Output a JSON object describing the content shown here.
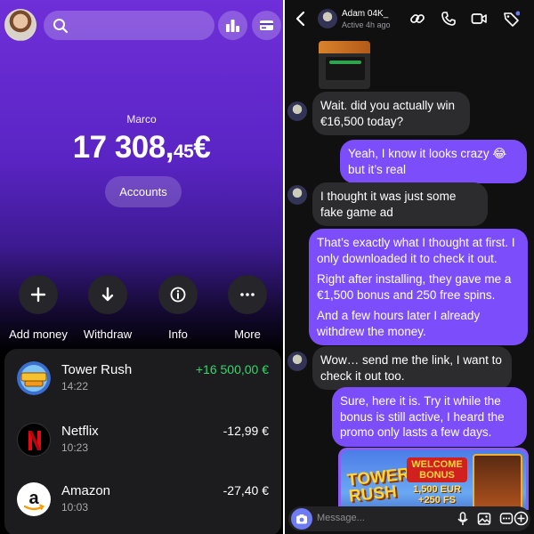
{
  "bank": {
    "owner": "Marco",
    "balance_main": "17 308,",
    "balance_cents": "45",
    "currency": "€",
    "accounts_label": "Accounts",
    "actions": [
      {
        "label": "Add money",
        "icon": "plus-icon"
      },
      {
        "label": "Withdraw",
        "icon": "arrow-down-icon"
      },
      {
        "label": "Info",
        "icon": "info-icon"
      },
      {
        "label": "More",
        "icon": "more-icon"
      }
    ],
    "transactions": [
      {
        "name": "Tower Rush",
        "time": "14:22",
        "amount": "+16 500,00 €",
        "icon": "tower-rush-logo"
      },
      {
        "name": "Netflix",
        "time": "10:23",
        "amount": "-12,99 €",
        "icon": "netflix-logo"
      },
      {
        "name": "Amazon",
        "time": "10:03",
        "amount": "-27,40 €",
        "icon": "amazon-logo"
      }
    ],
    "colors": {
      "accent": "#6f2fd8",
      "positive": "#36d66b"
    }
  },
  "chat": {
    "contact_name": "Adam 04K_",
    "contact_status": "Active 4h ago",
    "messages": [
      {
        "from": "in",
        "paragraphs": [
          "Wait. did you actually win €16,500 today?"
        ]
      },
      {
        "from": "out",
        "paragraphs": [
          "Yeah, I know it looks crazy 😂 but it’s real"
        ]
      },
      {
        "from": "in",
        "paragraphs": [
          "I thought it was just some fake game ad"
        ]
      },
      {
        "from": "out",
        "paragraphs": [
          "That’s exactly what I thought at first. I only downloaded it to check it out.",
          "Right after installing, they gave me a €1,500 bonus and 250 free spins.",
          "And a few hours later I already withdrew the money."
        ]
      },
      {
        "from": "in",
        "paragraphs": [
          "Wow… send me the link, I want to check it out too."
        ]
      },
      {
        "from": "out",
        "paragraphs": [
          "Sure, here it is. Try it while the bonus is still active, I heard the promo only lasts a few days."
        ]
      }
    ],
    "promo": {
      "title_line1": "TOWER",
      "title_line2": "RUSH",
      "welcome": "WELCOME BONUS",
      "bonus_line1": "1,500 EUR",
      "bonus_line2": "+250 FS"
    },
    "composer_placeholder": "Message...",
    "colors": {
      "outgoing": "#7c4dfa",
      "incoming": "#2c2c2e"
    }
  }
}
